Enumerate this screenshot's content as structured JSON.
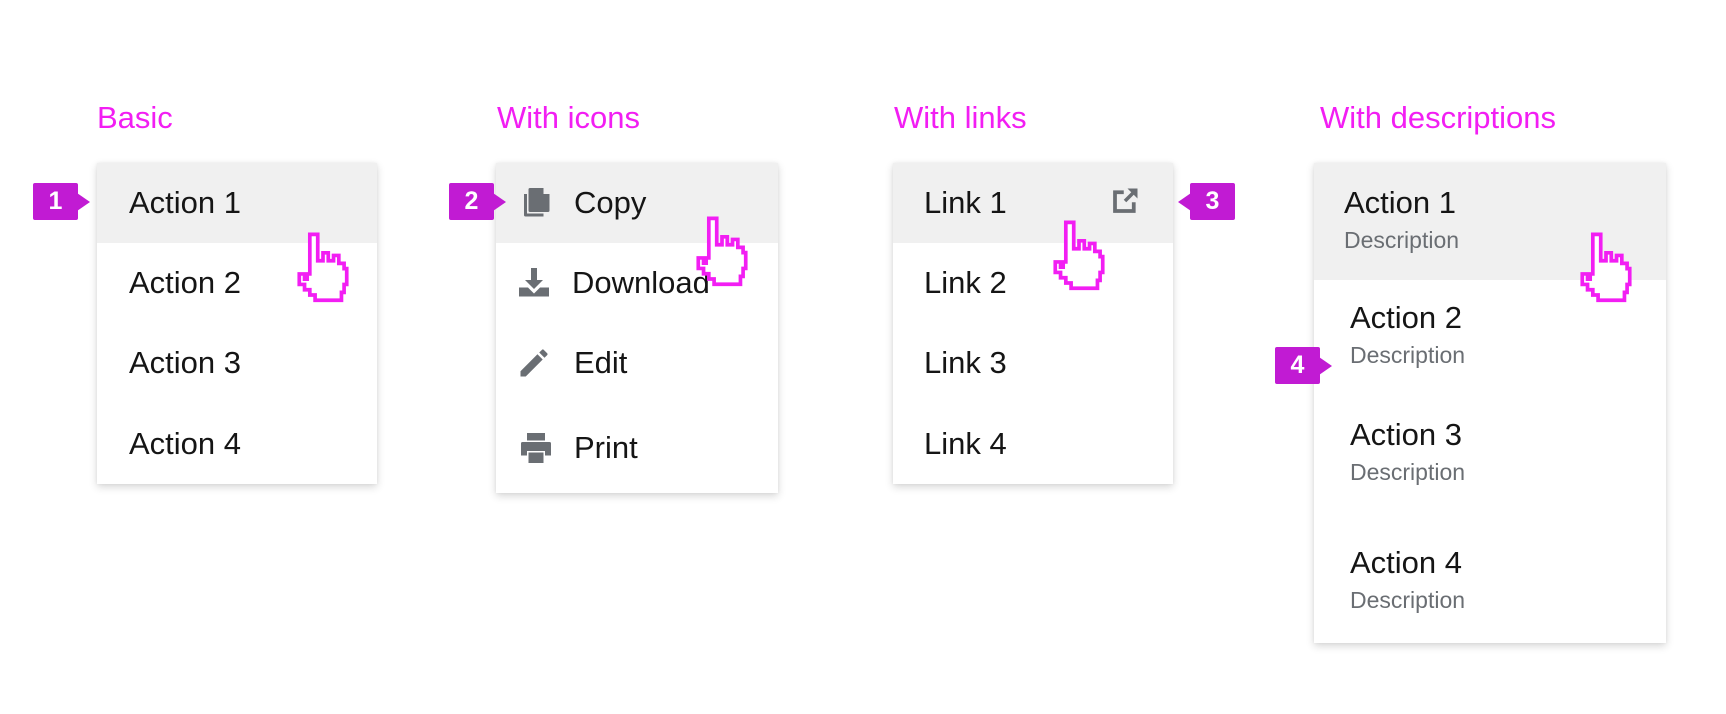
{
  "headings": {
    "basic": "Basic",
    "icons": "With icons",
    "links": "With links",
    "descriptions": "With descriptions"
  },
  "basic_menu": [
    "Action 1",
    "Action 2",
    "Action 3",
    "Action 4"
  ],
  "icons_menu": [
    {
      "label": "Copy",
      "icon": "copy-icon"
    },
    {
      "label": "Download",
      "icon": "download-icon"
    },
    {
      "label": "Edit",
      "icon": "pencil-icon"
    },
    {
      "label": "Print",
      "icon": "print-icon"
    }
  ],
  "links_menu": [
    {
      "label": "Link 1",
      "icon": "external-link-icon"
    },
    {
      "label": "Link 2"
    },
    {
      "label": "Link 3"
    },
    {
      "label": "Link 4"
    }
  ],
  "desc_menu": [
    {
      "title": "Action 1",
      "description": "Description"
    },
    {
      "title": "Action 2",
      "description": "Description"
    },
    {
      "title": "Action 3",
      "description": "Description"
    },
    {
      "title": "Action 4",
      "description": "Description"
    }
  ],
  "badges": [
    "1",
    "2",
    "3",
    "4"
  ],
  "colors": {
    "annotation": "#f21ef3",
    "badge": "#c11bd3",
    "hover_bg": "#f0f0f0",
    "icon": "#6a6e73"
  }
}
